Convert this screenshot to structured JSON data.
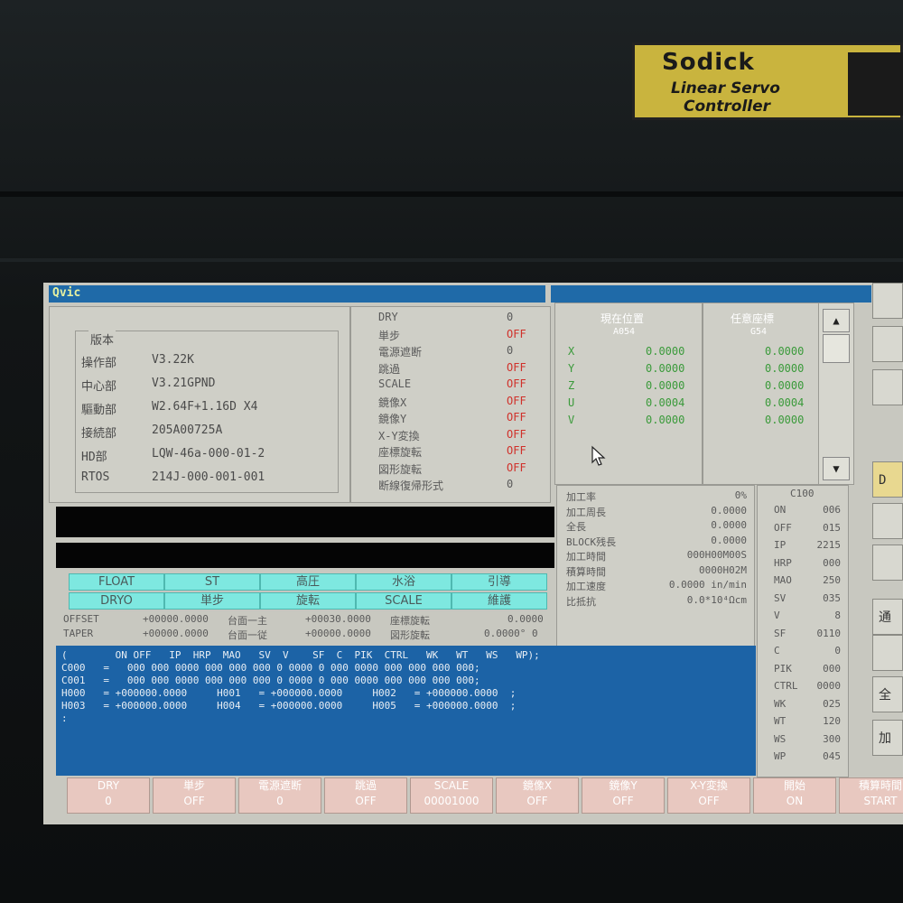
{
  "bezel": {
    "brand": "Sodick",
    "line1": "Linear Servo",
    "line2": "Controller"
  },
  "screen": {
    "title": "Qvic",
    "version_panel": {
      "heading": "版本",
      "rows": [
        {
          "label": "操作部",
          "value": "V3.22K"
        },
        {
          "label": "中心部",
          "value": "V3.21GPND"
        },
        {
          "label": "驅動部",
          "value": "W2.64F+1.16D X4"
        },
        {
          "label": "接続部",
          "value": "205A00725A"
        },
        {
          "label": "HD部",
          "value": "LQW-46a-000-01-2"
        },
        {
          "label": "RTOS",
          "value": "214J-000-001-001"
        }
      ]
    },
    "mode_list": [
      {
        "label": "DRY",
        "value": "0"
      },
      {
        "label": "単步",
        "value": "OFF"
      },
      {
        "label": "電源遮断",
        "value": "0"
      },
      {
        "label": "跳過",
        "value": "OFF"
      },
      {
        "label": "SCALE",
        "value": "OFF"
      },
      {
        "label": "鏡像X",
        "value": "OFF"
      },
      {
        "label": "鏡像Y",
        "value": "OFF"
      },
      {
        "label": "X-Y変換",
        "value": "OFF"
      },
      {
        "label": "座標旋転",
        "value": "OFF"
      },
      {
        "label": "図形旋転",
        "value": "OFF"
      },
      {
        "label": "断線復帰形式",
        "value": "0"
      }
    ],
    "current_position": {
      "heading": "現在位置",
      "sub": "A054",
      "axes": [
        {
          "axis": "X",
          "value": "0.0000"
        },
        {
          "axis": "Y",
          "value": "0.0000"
        },
        {
          "axis": "Z",
          "value": "0.0000"
        },
        {
          "axis": "U",
          "value": "0.0004"
        },
        {
          "axis": "V",
          "value": "0.0000"
        }
      ]
    },
    "work_coord": {
      "heading": "任意座標",
      "sub": "G54",
      "values": [
        "0.0000",
        "0.0000",
        "0.0000",
        "0.0004",
        "0.0000"
      ]
    },
    "machining": [
      {
        "label": "加工率",
        "value": "0%"
      },
      {
        "label": "加工周長",
        "value": "0.0000"
      },
      {
        "label": "全長",
        "value": "0.0000"
      },
      {
        "label": "BLOCK残長",
        "value": "0.0000"
      },
      {
        "label": "加工時間",
        "value": "000H00M00S"
      },
      {
        "label": "積算時間",
        "value": "0000H02M"
      },
      {
        "label": "加工速度",
        "value": "0.0000 in/min"
      },
      {
        "label": "比抵抗",
        "value": "0.0*10⁴Ωcm"
      }
    ],
    "condition": {
      "heading": "C100",
      "rows": [
        {
          "label": "ON",
          "value": "006"
        },
        {
          "label": "OFF",
          "value": "015"
        },
        {
          "label": "IP",
          "value": "2215"
        },
        {
          "label": "HRP",
          "value": "000"
        },
        {
          "label": "MAO",
          "value": "250"
        },
        {
          "label": "SV",
          "value": "035"
        },
        {
          "label": "V",
          "value": "8"
        },
        {
          "label": "SF",
          "value": "0110"
        },
        {
          "label": "C",
          "value": "0"
        },
        {
          "label": "PIK",
          "value": "000"
        },
        {
          "label": "CTRL",
          "value": "0000"
        },
        {
          "label": "WK",
          "value": "025"
        },
        {
          "label": "WT",
          "value": "120"
        },
        {
          "label": "WS",
          "value": "300"
        },
        {
          "label": "WP",
          "value": "045"
        }
      ]
    },
    "status_row1": [
      "FLOAT",
      "ST",
      "高圧",
      "水浴",
      "引導"
    ],
    "status_row2": [
      "DRYO",
      "単步",
      "旋転",
      "SCALE",
      "維護"
    ],
    "offset": {
      "offset_label": "OFFSET",
      "offset_value": "+00000.0000",
      "taper_label": "TAPER",
      "taper_value": "+00000.0000",
      "table1_label": "台面一主",
      "table1_value": "+00030.0000",
      "table2_label": "台面一従",
      "table2_value": "+00000.0000",
      "rot1_label": "座標旋転",
      "rot1_value": "0.0000",
      "rot2_label": "図形旋転",
      "rot2_value": "0.0000° 0"
    },
    "program_lines": [
      "(        ON OFF   IP  HRP  MAO   SV  V    SF  C  PIK  CTRL   WK   WT   WS   WP);",
      "C000   =   000 000 0000 000 000 000 0 0000 0 000 0000 000 000 000 000;",
      "C001   =   000 000 0000 000 000 000 0 0000 0 000 0000 000 000 000 000;",
      "H000   = +000000.0000     H001   = +000000.0000     H002   = +000000.0000  ;",
      "H003   = +000000.0000     H004   = +000000.0000     H005   = +000000.0000  ;",
      ":"
    ],
    "function_keys": [
      {
        "top": "DRY",
        "bottom": "0"
      },
      {
        "top": "単步",
        "bottom": "OFF"
      },
      {
        "top": "電源遮断",
        "bottom": "0"
      },
      {
        "top": "跳過",
        "bottom": "OFF"
      },
      {
        "top": "SCALE",
        "bottom": "00001000"
      },
      {
        "top": "鏡像X",
        "bottom": "OFF"
      },
      {
        "top": "鏡像Y",
        "bottom": "OFF"
      },
      {
        "top": "X-Y変換",
        "bottom": "OFF"
      },
      {
        "top": "開始",
        "bottom": "ON"
      },
      {
        "top": "積算時間",
        "bottom": "START"
      }
    ],
    "side_buttons": [
      "",
      "",
      "",
      "D",
      "",
      "",
      "通",
      "",
      "全",
      "加"
    ],
    "colors": {
      "title_bar": "#1f6aa8",
      "status_cyan": "#7ee8e0",
      "program_blue": "#1c63a6",
      "off_red": "#d0302a",
      "value_green": "#3a9a3a",
      "fkey_pink": "#e8c8c0"
    }
  }
}
